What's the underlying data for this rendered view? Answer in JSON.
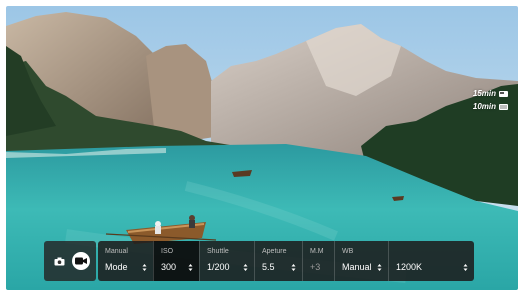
{
  "overlays": {
    "photo_remaining": "15min",
    "video_remaining": "10min"
  },
  "mode_toggle": {
    "photo_icon": "camera-icon",
    "video_icon": "video-camera-icon",
    "active": "video"
  },
  "controls": {
    "exposure_mode": {
      "label": "Manual",
      "value": "Mode"
    },
    "iso": {
      "label": "ISO",
      "value": "300"
    },
    "shutter": {
      "label": "Shuttle",
      "value": "1/200"
    },
    "aperture": {
      "label": "Apeture",
      "value": "5.5"
    },
    "metering": {
      "label": "M.M",
      "value": "+3"
    },
    "white_balance": {
      "label": "WB",
      "value": "Manual"
    },
    "color_temp": {
      "label": "",
      "value": "1200K"
    }
  },
  "colors": {
    "panel_bg": "#1c1c1c",
    "label_text": "#bdbdbd",
    "value_text": "#ffffff",
    "lake_turquoise": "#2fb6b3"
  }
}
